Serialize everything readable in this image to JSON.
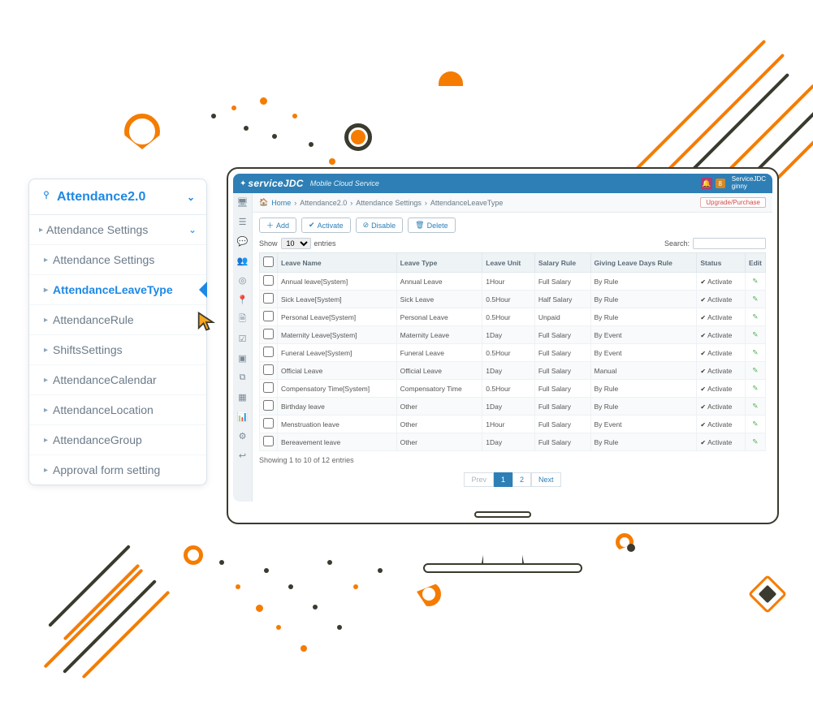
{
  "sidebar": {
    "root_label": "Attendance2.0",
    "group_label": "Attendance Settings",
    "items": [
      {
        "label": "Attendance Settings"
      },
      {
        "label": "AttendanceLeaveType"
      },
      {
        "label": "AttendanceRule"
      },
      {
        "label": "ShiftsSettings"
      },
      {
        "label": "AttendanceCalendar"
      },
      {
        "label": "AttendanceLocation"
      },
      {
        "label": "AttendanceGroup"
      },
      {
        "label": "Approval form setting"
      }
    ]
  },
  "header": {
    "brand": "serviceJDC",
    "slogan": "Mobile Cloud Service",
    "notif_count": "8",
    "user_line1": "ServiceJDC",
    "user_line2": "ginny"
  },
  "breadcrumb": {
    "home": "Home",
    "a": "Attendance2.0",
    "b": "Attendance Settings",
    "c": "AttendanceLeaveType",
    "upgrade": "Upgrade/Purchase"
  },
  "toolbar": {
    "add": "Add",
    "activate": "Activate",
    "disable": "Disable",
    "delete": "Delete"
  },
  "list": {
    "show": "Show",
    "entries": "entries",
    "page_size": "10",
    "search_label": "Search:",
    "info": "Showing 1 to 10 of 12 entries",
    "cols": {
      "name": "Leave Name",
      "type": "Leave Type",
      "unit": "Leave Unit",
      "salary": "Salary Rule",
      "days": "Giving Leave Days Rule",
      "status": "Status",
      "edit": "Edit"
    },
    "status_label": "Activate",
    "rows": [
      {
        "name": "Annual leave[System]",
        "type": "Annual Leave",
        "unit": "1Hour",
        "salary": "Full Salary",
        "days": "By Rule"
      },
      {
        "name": "Sick Leave[System]",
        "type": "Sick Leave",
        "unit": "0.5Hour",
        "salary": "Half Salary",
        "days": "By Rule"
      },
      {
        "name": "Personal Leave[System]",
        "type": "Personal Leave",
        "unit": "0.5Hour",
        "salary": "Unpaid",
        "days": "By Rule"
      },
      {
        "name": "Maternity Leave[System]",
        "type": "Maternity Leave",
        "unit": "1Day",
        "salary": "Full Salary",
        "days": "By Event"
      },
      {
        "name": "Funeral Leave[System]",
        "type": "Funeral Leave",
        "unit": "0.5Hour",
        "salary": "Full Salary",
        "days": "By Event"
      },
      {
        "name": "Official Leave",
        "type": "Official Leave",
        "unit": "1Day",
        "salary": "Full Salary",
        "days": "Manual"
      },
      {
        "name": "Compensatory Time[System]",
        "type": "Compensatory Time",
        "unit": "0.5Hour",
        "salary": "Full Salary",
        "days": "By Rule"
      },
      {
        "name": "Birthday leave",
        "type": "Other",
        "unit": "1Day",
        "salary": "Full Salary",
        "days": "By Rule"
      },
      {
        "name": "Menstruation leave",
        "type": "Other",
        "unit": "1Hour",
        "salary": "Full Salary",
        "days": "By Event"
      },
      {
        "name": "Bereavement leave",
        "type": "Other",
        "unit": "1Day",
        "salary": "Full Salary",
        "days": "By Rule"
      }
    ]
  },
  "pager": {
    "prev": "Prev",
    "p1": "1",
    "p2": "2",
    "next": "Next"
  }
}
